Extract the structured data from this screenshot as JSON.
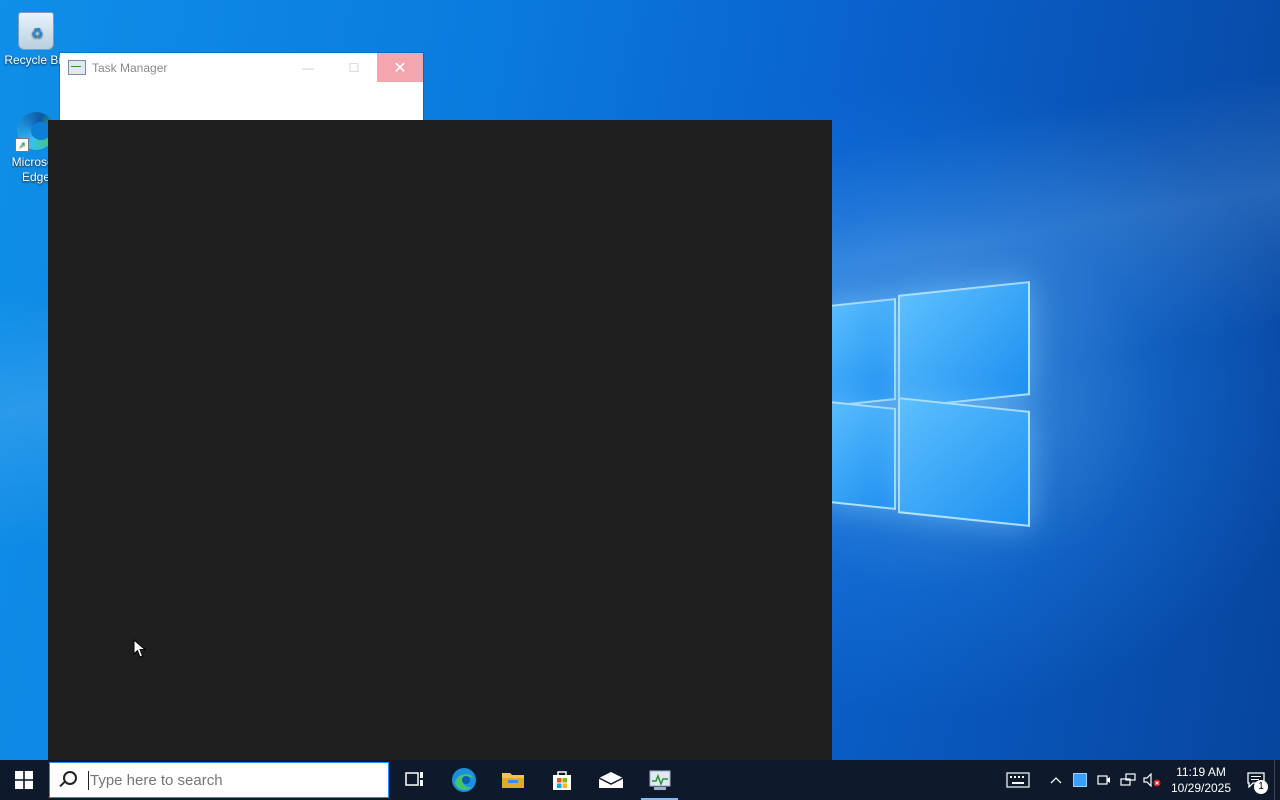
{
  "desktop": {
    "icons": [
      {
        "label": "Recycle Bin"
      },
      {
        "label": "Microsoft Edge"
      }
    ]
  },
  "task_manager": {
    "title": "Task Manager",
    "minimize_glyph": "—",
    "maximize_glyph": "☐",
    "close_glyph": "✕"
  },
  "taskbar": {
    "search_placeholder": "Type here to search",
    "apps": [
      "task-view",
      "edge",
      "file-explorer",
      "microsoft-store",
      "mail",
      "task-manager"
    ],
    "active_app": "task-manager"
  },
  "tray": {
    "time": "11:19 AM",
    "date": "10/29/2025",
    "notification_count": "1",
    "icons": [
      "keyboard-icon",
      "chevron-up-icon",
      "blue-square-icon",
      "meet-now-icon",
      "network-icon",
      "volume-muted-icon"
    ]
  },
  "colors": {
    "taskbar": "#0e1a2b",
    "console_bg": "#1f1f1f",
    "close_hover": "#f2a6ae",
    "accent": "#1e90ff"
  }
}
